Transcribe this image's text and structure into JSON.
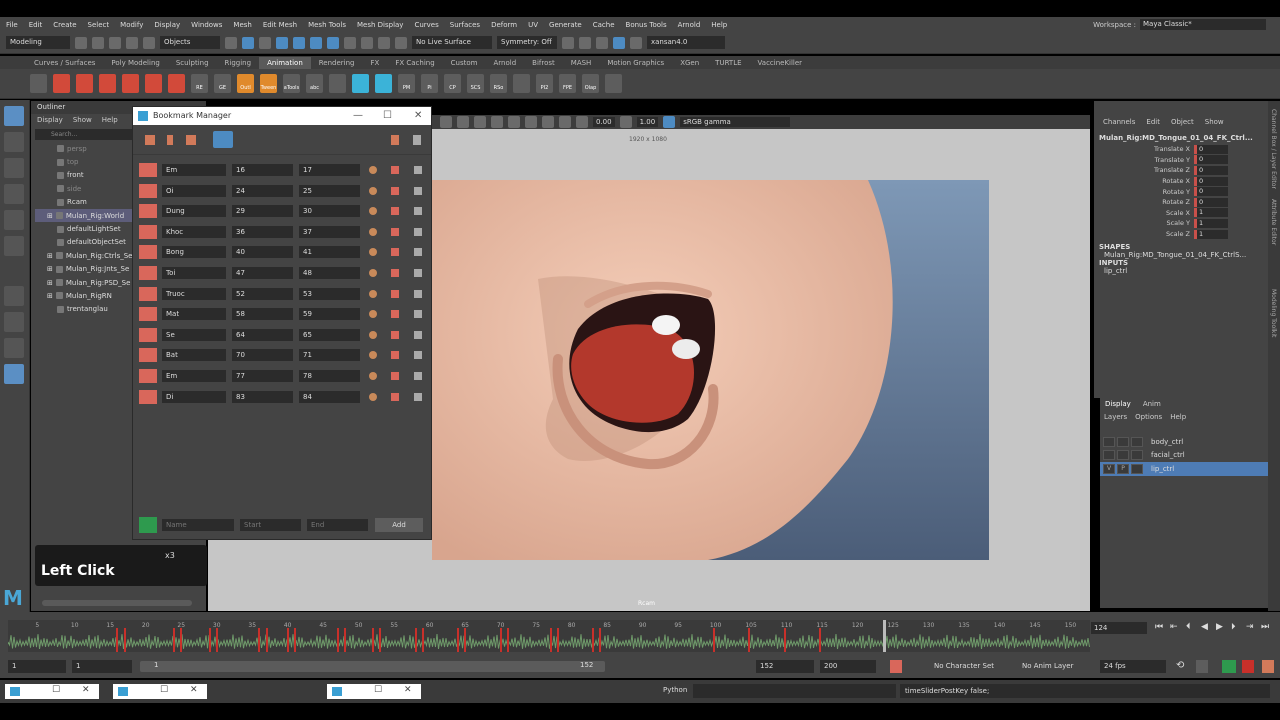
{
  "menubar": [
    "File",
    "Edit",
    "Create",
    "Select",
    "Modify",
    "Display",
    "Windows",
    "Mesh",
    "Edit Mesh",
    "Mesh Tools",
    "Mesh Display",
    "Curves",
    "Surfaces",
    "Deform",
    "UV",
    "Generate",
    "Cache",
    "Bonus Tools",
    "Arnold",
    "Help"
  ],
  "workspace": {
    "label": "Workspace :",
    "value": "Maya Classic*"
  },
  "status": {
    "menuset": "Modeling",
    "selmode": "Objects",
    "live": "No Live Surface",
    "symmetry": "Symmetry: Off",
    "user": "xansan4.0"
  },
  "shelf_tabs": [
    "Curves / Surfaces",
    "Poly Modeling",
    "Sculpting",
    "Rigging",
    "Animation",
    "Rendering",
    "FX",
    "FX Caching",
    "Custom",
    "Arnold",
    "Bifrost",
    "MASH",
    "Motion Graphics",
    "XGen",
    "TURTLE",
    "VaccineKiller"
  ],
  "shelf_active": "Animation",
  "shelf_icons": [
    "RE",
    "GE",
    "Outl",
    "Tween",
    "aTools",
    "abc",
    "",
    "",
    "",
    "PM",
    "Pi",
    "CP",
    "SCS",
    "RSo",
    "",
    "PI2",
    "FPE",
    "Olap",
    ""
  ],
  "outliner": {
    "title": "Outliner",
    "menu": [
      "Display",
      "Show",
      "Help"
    ],
    "search": "Search...",
    "items": [
      {
        "label": "persp",
        "dim": true
      },
      {
        "label": "top",
        "dim": true
      },
      {
        "label": "front",
        "dim": false
      },
      {
        "label": "side",
        "dim": true
      },
      {
        "label": "Rcam",
        "dim": false
      },
      {
        "label": "Mulan_Rig:World",
        "dim": false,
        "sel": true
      },
      {
        "label": "defaultLightSet",
        "dim": false
      },
      {
        "label": "defaultObjectSet",
        "dim": false
      },
      {
        "label": "Mulan_Rig:Ctrls_Se",
        "dim": false
      },
      {
        "label": "Mulan_Rig:Jnts_Se",
        "dim": false
      },
      {
        "label": "Mulan_Rig:PSD_Se",
        "dim": false
      },
      {
        "label": "Mulan_RigRN",
        "dim": false
      },
      {
        "label": "trentanglau",
        "dim": false
      }
    ]
  },
  "tooltip": {
    "action": "Left Click",
    "count": "x3"
  },
  "viewport": {
    "resolution": "1920 x 1080",
    "val1": "0.00",
    "val2": "1.00",
    "colorspace": "sRGB gamma",
    "camera": "Rcam"
  },
  "bookmark_manager": {
    "title": "Bookmark Manager",
    "rows": [
      {
        "name": "Em",
        "start": "16",
        "end": "17"
      },
      {
        "name": "Oi",
        "start": "24",
        "end": "25"
      },
      {
        "name": "Dung",
        "start": "29",
        "end": "30"
      },
      {
        "name": "Khoc",
        "start": "36",
        "end": "37"
      },
      {
        "name": "Bong",
        "start": "40",
        "end": "41"
      },
      {
        "name": "Toi",
        "start": "47",
        "end": "48"
      },
      {
        "name": "Truoc",
        "start": "52",
        "end": "53"
      },
      {
        "name": "Mat",
        "start": "58",
        "end": "59"
      },
      {
        "name": "Se",
        "start": "64",
        "end": "65"
      },
      {
        "name": "Bat",
        "start": "70",
        "end": "71"
      },
      {
        "name": "Em",
        "start": "77",
        "end": "78"
      },
      {
        "name": "Di",
        "start": "83",
        "end": "84"
      }
    ],
    "name_placeholder": "Name",
    "start_placeholder": "Start",
    "end_placeholder": "End",
    "add_label": "Add",
    "colors": {
      "swatch": "#d9675b",
      "add_swatch": "#2e9a4e"
    }
  },
  "channel_box": {
    "menu": [
      "Channels",
      "Edit",
      "Object",
      "Show"
    ],
    "object": "Mulan_Rig:MD_Tongue_01_04_FK_Ctrl...",
    "attrs": [
      {
        "name": "Translate X",
        "value": "0"
      },
      {
        "name": "Translate Y",
        "value": "0"
      },
      {
        "name": "Translate Z",
        "value": "0"
      },
      {
        "name": "Rotate X",
        "value": "0"
      },
      {
        "name": "Rotate Y",
        "value": "0"
      },
      {
        "name": "Rotate Z",
        "value": "0"
      },
      {
        "name": "Scale X",
        "value": "1"
      },
      {
        "name": "Scale Y",
        "value": "1"
      },
      {
        "name": "Scale Z",
        "value": "1"
      }
    ],
    "shapes_label": "SHAPES",
    "shape": "Mulan_Rig:MD_Tongue_01_04_FK_CtrlS...",
    "inputs_label": "INPUTS",
    "input": "lip_ctrl"
  },
  "side_tabs": [
    "Channel Box / Layer Editor",
    "Attribute Editor",
    "Modeling Toolkit"
  ],
  "layers": {
    "tabs": [
      "Display",
      "Anim"
    ],
    "menu": [
      "Layers",
      "Options",
      "Help"
    ],
    "items": [
      {
        "name": "body_ctrl",
        "v": "",
        "p": "",
        "sel": false
      },
      {
        "name": "facial_ctrl",
        "v": "",
        "p": "",
        "sel": false
      },
      {
        "name": "lip_ctrl",
        "v": "V",
        "p": "P",
        "sel": true
      }
    ]
  },
  "timeline": {
    "ticks": [
      "5",
      "10",
      "15",
      "20",
      "25",
      "30",
      "35",
      "40",
      "45",
      "50",
      "55",
      "60",
      "65",
      "70",
      "75",
      "80",
      "85",
      "90",
      "95",
      "100",
      "105",
      "110",
      "115",
      "120",
      "125",
      "130",
      "135",
      "140",
      "145",
      "150"
    ],
    "keys": [
      16,
      17,
      24,
      25,
      29,
      30,
      36,
      37,
      40,
      41,
      47,
      48,
      52,
      53,
      58,
      59,
      64,
      65,
      70,
      71,
      77,
      78,
      83,
      84,
      100,
      105,
      110,
      115
    ],
    "current": "124",
    "current_frame": 124
  },
  "range": {
    "start": "1",
    "inner_start": "1",
    "slider_start": "1",
    "slider_end": "152",
    "inner_end": "152",
    "end": "200",
    "character": "No Character Set",
    "anim_layer": "No Anim Layer",
    "fps": "24 fps"
  },
  "command": {
    "label": "Python",
    "result": "timeSliderPostKey false;"
  }
}
